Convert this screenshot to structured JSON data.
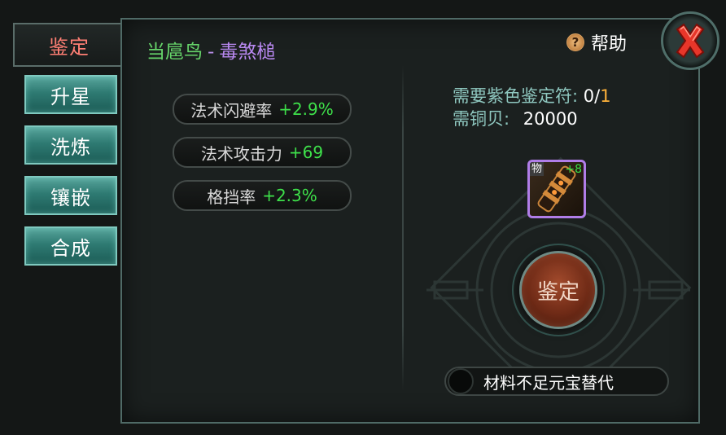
{
  "tabs": [
    {
      "label": "鉴定",
      "active": true
    },
    {
      "label": "升星"
    },
    {
      "label": "洗炼"
    },
    {
      "label": "镶嵌"
    },
    {
      "label": "合成"
    }
  ],
  "title": {
    "name": "当扈鸟",
    "separator": "-",
    "item": "毒煞槌"
  },
  "attributes": [
    {
      "name": "法术闪避率",
      "value": "+2.9%"
    },
    {
      "name": "法术攻击力",
      "value": "+69"
    },
    {
      "name": "格挡率",
      "value": "+2.3%"
    }
  ],
  "help": {
    "label": "帮助",
    "icon": "question-icon"
  },
  "close": {
    "icon": "close-x-icon"
  },
  "requirements": {
    "symbol_label": "需要紫色鉴定符:",
    "symbol_have": "0/",
    "symbol_need": "1",
    "copper_label": "需铜贝:",
    "copper_value": "20000"
  },
  "item_slot": {
    "tag": "物",
    "plus": "+8",
    "icon": "hammer-weapon-icon"
  },
  "identify_button": {
    "label": "鉴定"
  },
  "substitute": {
    "label": "材料不足元宝替代",
    "checked": false
  },
  "colors": {
    "green": "#66d46a",
    "purple": "#b888f0",
    "attr_value": "#3ee04a",
    "gold": "#ffb23a",
    "tab_teal": "#2e7a72",
    "active_tab_text": "#ff7f74"
  }
}
